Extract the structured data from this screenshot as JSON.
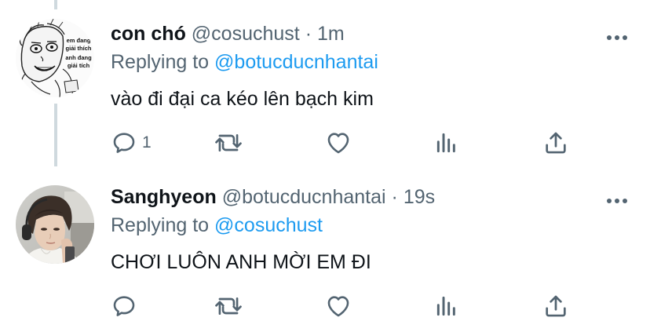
{
  "tweets": [
    {
      "display_name": "con chó",
      "handle": "@cosuchust",
      "separator": "·",
      "time": "1m",
      "replying_prefix": "Replying to",
      "replying_to": "@botucducnhantai",
      "text": "vào đi đại ca kéo lên bạch kim",
      "avatar_caption": [
        "em đang",
        "giải thích",
        "anh đang",
        "giải tích"
      ],
      "reply_count": "1"
    },
    {
      "display_name": "Sanghyeon",
      "handle": "@botucducnhantai",
      "separator": "·",
      "time": "19s",
      "replying_prefix": "Replying to",
      "replying_to": "@cosuchust",
      "text": "CHƠI LUÔN ANH MỜI EM ĐI",
      "reply_count": ""
    }
  ],
  "icons": {
    "more": "more-horizontal-icon",
    "reply": "reply-bubble-icon",
    "retweet": "retweet-icon",
    "like": "heart-icon",
    "stats": "analytics-icon",
    "share": "share-icon"
  },
  "colors": {
    "link": "#1d9bf0",
    "secondary_text": "#536471",
    "thread_line": "#cfd9de"
  }
}
